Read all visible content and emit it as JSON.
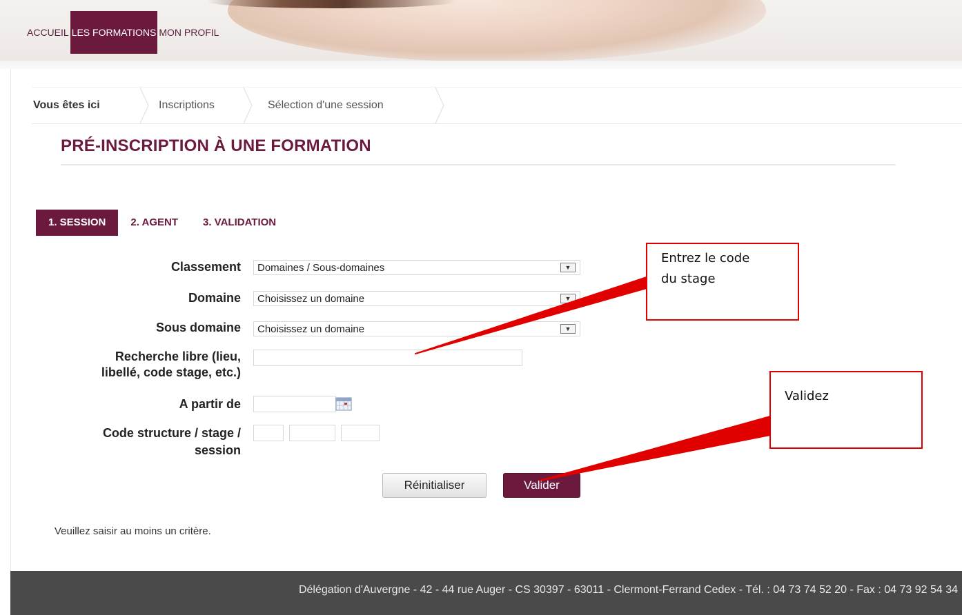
{
  "top_nav": [
    {
      "label": "ACCUEIL",
      "active": false
    },
    {
      "label": "LES FORMATIONS",
      "active": true
    },
    {
      "label": "MON PROFIL",
      "active": false
    }
  ],
  "breadcrumb": {
    "intro": "Vous êtes ici",
    "items": [
      "Inscriptions",
      "Sélection d'une session"
    ]
  },
  "page_title": "PRÉ-INSCRIPTION À UNE FORMATION",
  "steps": [
    {
      "label": "1. SESSION",
      "active": true
    },
    {
      "label": "2. AGENT",
      "active": false
    },
    {
      "label": "3. VALIDATION",
      "active": false
    }
  ],
  "form": {
    "classement": {
      "label": "Classement",
      "value": "Domaines / Sous-domaines"
    },
    "domaine": {
      "label": "Domaine",
      "value": "Choisissez un domaine"
    },
    "sous_domaine": {
      "label": "Sous domaine",
      "value": "Choisissez un domaine"
    },
    "recherche": {
      "label_line1": "Recherche libre (lieu,",
      "label_line2": "libellé, code stage, etc.)",
      "value": ""
    },
    "a_partir_de": {
      "label": "A partir de",
      "value": ""
    },
    "code": {
      "label_line1": "Code structure / stage /",
      "label_line2": "session",
      "structure": "",
      "stage": "",
      "session": ""
    },
    "reset_label": "Réinitialiser",
    "validate_label": "Valider"
  },
  "hint": "Veuillez saisir au moins un critère.",
  "footer": "Délégation d'Auvergne - 42 - 44 rue Auger - CS 30397 - 63011 - Clermont-Ferrand Cedex - Tél. : 04 73 74 52 20 - Fax : 04 73 92 54 34",
  "annotations": {
    "code_callout": {
      "line1": "Entrez le code",
      "line2": "du stage"
    },
    "validate_callout": "Validez"
  },
  "colors": {
    "brand": "#6b1a3e",
    "annotation": "#e10000",
    "footer_bg": "#4a4a4a"
  }
}
